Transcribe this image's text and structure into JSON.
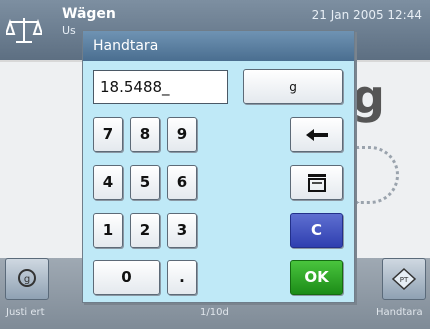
{
  "header": {
    "app_title": "Wägen",
    "user_label": "Us",
    "datetime": "21 Jan 2005 12:44"
  },
  "background": {
    "weight_fragment": "g"
  },
  "footer": {
    "left_label": "Justi ert",
    "center_label": "1/10d",
    "right_label": "Handtara"
  },
  "dialog": {
    "title": "Handtara",
    "input_value": "18.5488_",
    "unit_button": "g",
    "keys": {
      "k7": "7",
      "k8": "8",
      "k9": "9",
      "k4": "4",
      "k5": "5",
      "k6": "6",
      "k1": "1",
      "k2": "2",
      "k3": "3",
      "k0": "0",
      "kdot": ".",
      "clear": "C",
      "ok": "OK"
    },
    "icons": {
      "backspace": "left-arrow-icon",
      "tare": "tare-scale-icon"
    }
  },
  "colors": {
    "dialog_bg": "#bfe9f7",
    "title_bar": "#5a7fa2",
    "ok_button": "#2aa322",
    "clear_button": "#3344b8"
  }
}
